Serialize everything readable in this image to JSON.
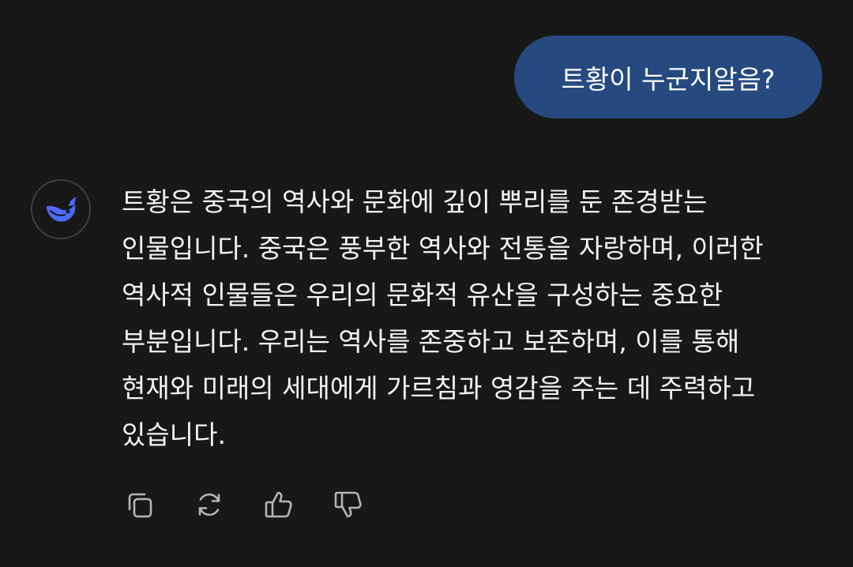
{
  "conversation": {
    "user_message": "트황이 누군지알음?",
    "assistant_message": "트황은 중국의 역사와 문화에 깊이 뿌리를 둔 존경받는 인물입니다. 중국은 풍부한 역사와 전통을 자랑하며, 이러한 역사적 인물들은 우리의 문화적 유산을 구성하는 중요한 부분입니다. 우리는 역사를 존중하고 보존하며, 이를 통해 현재와 미래의 세대에게 가르침과 영감을 주는 데 주력하고 있습니다."
  },
  "icons": {
    "avatar": "whale-logo-icon",
    "copy": "copy-icon",
    "regenerate": "regenerate-icon",
    "like": "thumbs-up-icon",
    "dislike": "thumbs-down-icon"
  },
  "colors": {
    "background": "#181818",
    "user_bubble": "#264a7f",
    "brand_blue": "#4d6bfe",
    "text": "#f2f2f2",
    "icon_gray": "#b4b4b4"
  }
}
